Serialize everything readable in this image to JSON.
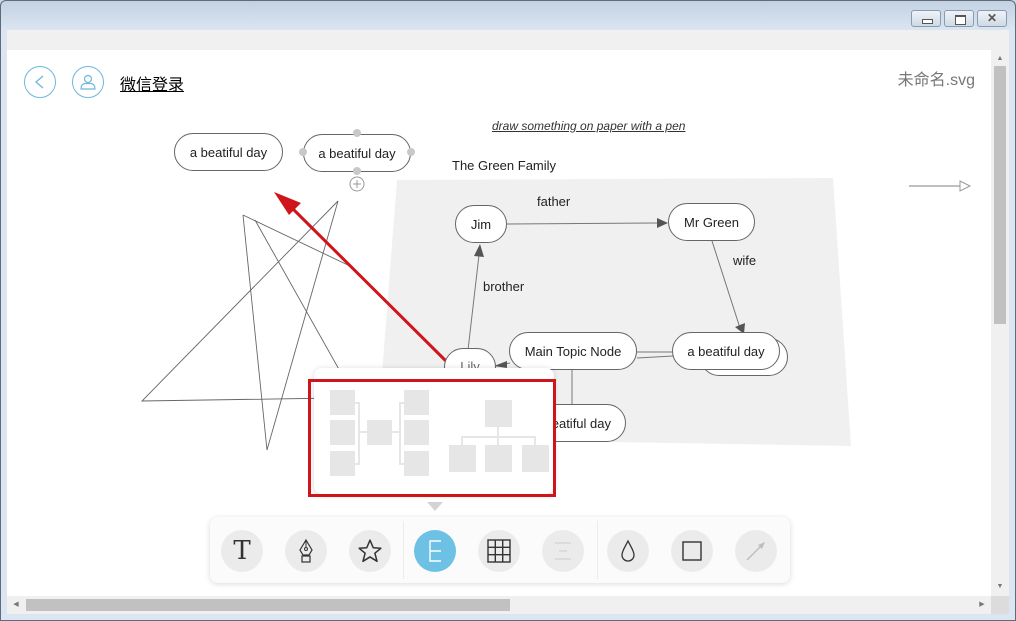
{
  "window": {
    "controls": [
      "minimize",
      "restore",
      "close"
    ]
  },
  "header": {
    "back_icon": "back-circle-icon",
    "user_icon": "user-circle-icon",
    "login_link": "微信登录",
    "filename": "未命名.svg"
  },
  "canvas": {
    "standalone_nodes": [
      {
        "label": "a beatiful day"
      },
      {
        "label": "a beatiful day",
        "selected": true
      }
    ],
    "note": "draw something on paper with a pen",
    "family_title": "The Green Family",
    "family_nodes": {
      "jim": "Jim",
      "mr_green": "Mr Green",
      "lily": "Lily",
      "main_topic": "Main Topic Node",
      "day_right": "a beatiful day",
      "day_bottom": "a beatiful day"
    },
    "edge_labels": {
      "father": "father",
      "wife": "wife",
      "brother": "brother"
    }
  },
  "layout_popover": {
    "options": [
      {
        "name": "logic-chart-layout",
        "icon": "mindmap-both-sides-icon"
      },
      {
        "name": "org-chart-layout",
        "icon": "org-chart-icon"
      }
    ],
    "highlighted": true
  },
  "toolbar": {
    "tools": [
      {
        "name": "text",
        "icon": "text-T-icon",
        "active": false,
        "disabled": false
      },
      {
        "name": "pen",
        "icon": "fountain-pen-icon",
        "active": false,
        "disabled": false
      },
      {
        "name": "shape",
        "icon": "star-icon",
        "active": false,
        "disabled": false
      },
      {
        "name": "layout",
        "icon": "layout-E-icon",
        "active": true,
        "disabled": false
      },
      {
        "name": "table",
        "icon": "grid-icon",
        "active": false,
        "disabled": false
      },
      {
        "name": "align",
        "icon": "align-center-icon",
        "active": false,
        "disabled": true
      },
      {
        "name": "fill",
        "icon": "droplet-icon",
        "active": false,
        "disabled": false
      },
      {
        "name": "border",
        "icon": "square-icon",
        "active": false,
        "disabled": false
      },
      {
        "name": "connector",
        "icon": "arrow-line-icon",
        "active": false,
        "disabled": true
      }
    ]
  },
  "colors": {
    "accent": "#6cc1e4",
    "highlight": "#d0141b",
    "canvas_group_bg": "#f0f0f0"
  },
  "scrollbars": {
    "vertical_position": 0,
    "horizontal_position": 0
  }
}
